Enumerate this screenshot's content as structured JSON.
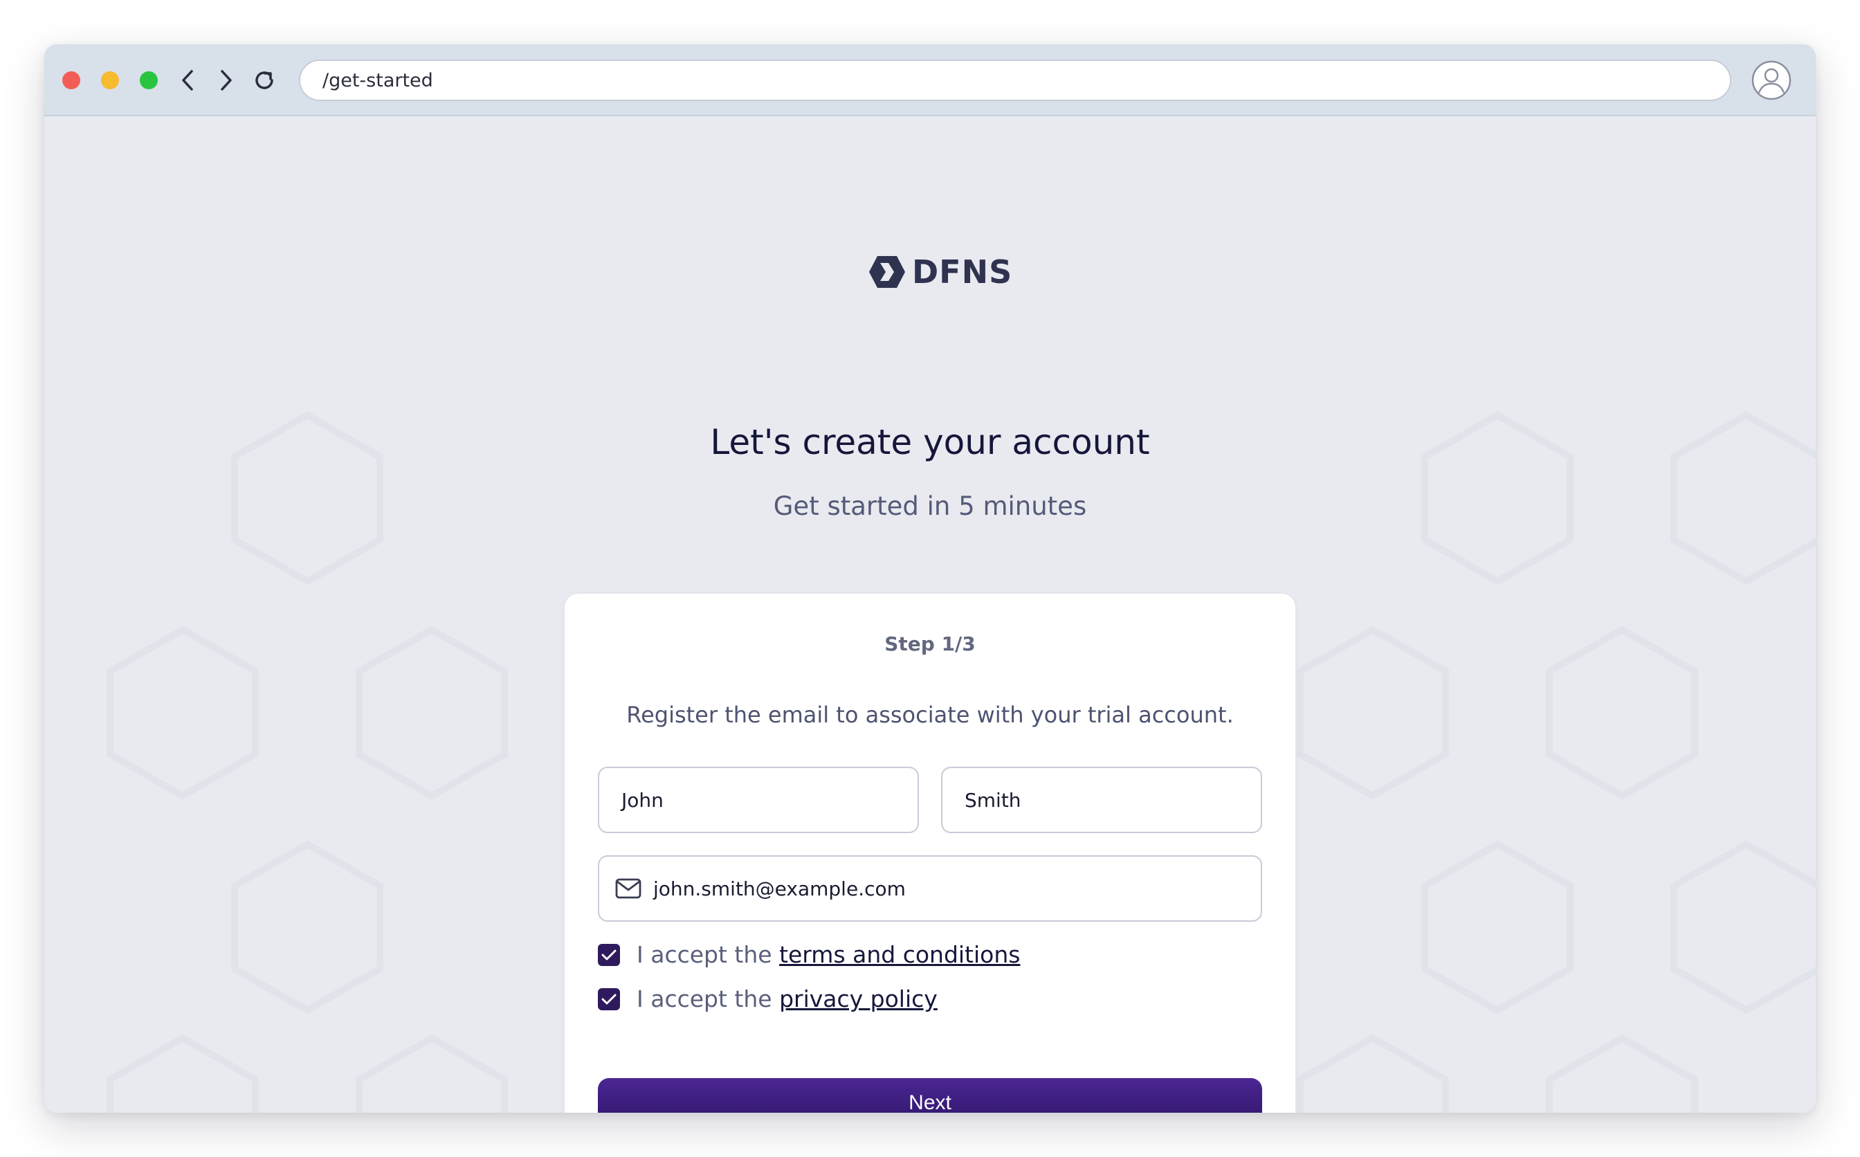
{
  "browser": {
    "url": "/get-started"
  },
  "brand": {
    "name": "DFNS",
    "logo_color": "#2f3350"
  },
  "page": {
    "title": "Let's create your account",
    "subtitle": "Get started in 5 minutes"
  },
  "form": {
    "step": "Step 1/3",
    "instruction": "Register the email to associate with your trial account.",
    "first_name": "John",
    "last_name": "Smith",
    "email": "john.smith@example.com",
    "email_icon": "envelope-icon",
    "terms": {
      "prefix": "I accept the ",
      "link": "terms and conditions",
      "checked": true
    },
    "privacy": {
      "prefix": "I accept the ",
      "link": "privacy policy",
      "checked": true
    },
    "next_label": "Next"
  },
  "colors": {
    "accent": "#3a1d7a",
    "background": "#e9eaef",
    "chrome": "#d8e0ea"
  }
}
